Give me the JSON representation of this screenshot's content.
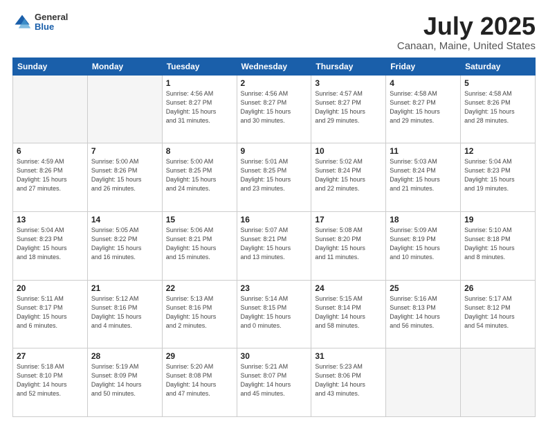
{
  "header": {
    "logo_general": "General",
    "logo_blue": "Blue",
    "title": "July 2025",
    "subtitle": "Canaan, Maine, United States"
  },
  "weekdays": [
    "Sunday",
    "Monday",
    "Tuesday",
    "Wednesday",
    "Thursday",
    "Friday",
    "Saturday"
  ],
  "weeks": [
    [
      {
        "day": "",
        "info": ""
      },
      {
        "day": "",
        "info": ""
      },
      {
        "day": "1",
        "info": "Sunrise: 4:56 AM\nSunset: 8:27 PM\nDaylight: 15 hours\nand 31 minutes."
      },
      {
        "day": "2",
        "info": "Sunrise: 4:56 AM\nSunset: 8:27 PM\nDaylight: 15 hours\nand 30 minutes."
      },
      {
        "day": "3",
        "info": "Sunrise: 4:57 AM\nSunset: 8:27 PM\nDaylight: 15 hours\nand 29 minutes."
      },
      {
        "day": "4",
        "info": "Sunrise: 4:58 AM\nSunset: 8:27 PM\nDaylight: 15 hours\nand 29 minutes."
      },
      {
        "day": "5",
        "info": "Sunrise: 4:58 AM\nSunset: 8:26 PM\nDaylight: 15 hours\nand 28 minutes."
      }
    ],
    [
      {
        "day": "6",
        "info": "Sunrise: 4:59 AM\nSunset: 8:26 PM\nDaylight: 15 hours\nand 27 minutes."
      },
      {
        "day": "7",
        "info": "Sunrise: 5:00 AM\nSunset: 8:26 PM\nDaylight: 15 hours\nand 26 minutes."
      },
      {
        "day": "8",
        "info": "Sunrise: 5:00 AM\nSunset: 8:25 PM\nDaylight: 15 hours\nand 24 minutes."
      },
      {
        "day": "9",
        "info": "Sunrise: 5:01 AM\nSunset: 8:25 PM\nDaylight: 15 hours\nand 23 minutes."
      },
      {
        "day": "10",
        "info": "Sunrise: 5:02 AM\nSunset: 8:24 PM\nDaylight: 15 hours\nand 22 minutes."
      },
      {
        "day": "11",
        "info": "Sunrise: 5:03 AM\nSunset: 8:24 PM\nDaylight: 15 hours\nand 21 minutes."
      },
      {
        "day": "12",
        "info": "Sunrise: 5:04 AM\nSunset: 8:23 PM\nDaylight: 15 hours\nand 19 minutes."
      }
    ],
    [
      {
        "day": "13",
        "info": "Sunrise: 5:04 AM\nSunset: 8:23 PM\nDaylight: 15 hours\nand 18 minutes."
      },
      {
        "day": "14",
        "info": "Sunrise: 5:05 AM\nSunset: 8:22 PM\nDaylight: 15 hours\nand 16 minutes."
      },
      {
        "day": "15",
        "info": "Sunrise: 5:06 AM\nSunset: 8:21 PM\nDaylight: 15 hours\nand 15 minutes."
      },
      {
        "day": "16",
        "info": "Sunrise: 5:07 AM\nSunset: 8:21 PM\nDaylight: 15 hours\nand 13 minutes."
      },
      {
        "day": "17",
        "info": "Sunrise: 5:08 AM\nSunset: 8:20 PM\nDaylight: 15 hours\nand 11 minutes."
      },
      {
        "day": "18",
        "info": "Sunrise: 5:09 AM\nSunset: 8:19 PM\nDaylight: 15 hours\nand 10 minutes."
      },
      {
        "day": "19",
        "info": "Sunrise: 5:10 AM\nSunset: 8:18 PM\nDaylight: 15 hours\nand 8 minutes."
      }
    ],
    [
      {
        "day": "20",
        "info": "Sunrise: 5:11 AM\nSunset: 8:17 PM\nDaylight: 15 hours\nand 6 minutes."
      },
      {
        "day": "21",
        "info": "Sunrise: 5:12 AM\nSunset: 8:16 PM\nDaylight: 15 hours\nand 4 minutes."
      },
      {
        "day": "22",
        "info": "Sunrise: 5:13 AM\nSunset: 8:16 PM\nDaylight: 15 hours\nand 2 minutes."
      },
      {
        "day": "23",
        "info": "Sunrise: 5:14 AM\nSunset: 8:15 PM\nDaylight: 15 hours\nand 0 minutes."
      },
      {
        "day": "24",
        "info": "Sunrise: 5:15 AM\nSunset: 8:14 PM\nDaylight: 14 hours\nand 58 minutes."
      },
      {
        "day": "25",
        "info": "Sunrise: 5:16 AM\nSunset: 8:13 PM\nDaylight: 14 hours\nand 56 minutes."
      },
      {
        "day": "26",
        "info": "Sunrise: 5:17 AM\nSunset: 8:12 PM\nDaylight: 14 hours\nand 54 minutes."
      }
    ],
    [
      {
        "day": "27",
        "info": "Sunrise: 5:18 AM\nSunset: 8:10 PM\nDaylight: 14 hours\nand 52 minutes."
      },
      {
        "day": "28",
        "info": "Sunrise: 5:19 AM\nSunset: 8:09 PM\nDaylight: 14 hours\nand 50 minutes."
      },
      {
        "day": "29",
        "info": "Sunrise: 5:20 AM\nSunset: 8:08 PM\nDaylight: 14 hours\nand 47 minutes."
      },
      {
        "day": "30",
        "info": "Sunrise: 5:21 AM\nSunset: 8:07 PM\nDaylight: 14 hours\nand 45 minutes."
      },
      {
        "day": "31",
        "info": "Sunrise: 5:23 AM\nSunset: 8:06 PM\nDaylight: 14 hours\nand 43 minutes."
      },
      {
        "day": "",
        "info": ""
      },
      {
        "day": "",
        "info": ""
      }
    ]
  ]
}
